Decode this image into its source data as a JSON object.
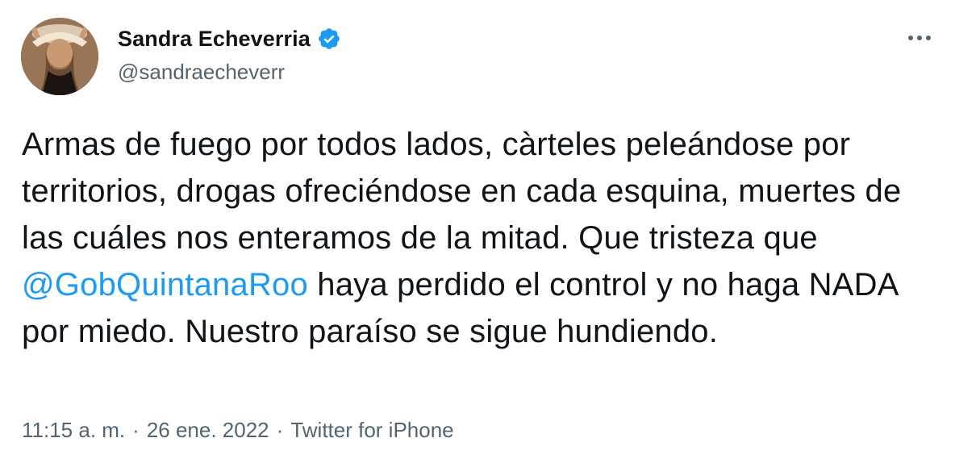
{
  "author": {
    "display_name": "Sandra Echeverria",
    "handle": "@sandraecheverr",
    "verified": true
  },
  "tweet": {
    "text_before_mention": "Armas de fuego por todos lados, càrteles peleándose por territorios, drogas ofreciéndose en cada esquina, muertes de las cuáles nos enteramos de la mitad. Que tristeza que ",
    "mention": "@GobQuintanaRoo",
    "text_after_mention": " haya perdido el control y no haga NADA por miedo. Nuestro paraíso se sigue hundiendo."
  },
  "meta": {
    "time": "11:15 a. m.",
    "separator": "·",
    "date": "26 ene. 2022",
    "source": "Twitter for iPhone"
  },
  "icons": {
    "verified": "verified-badge-icon",
    "more": "more-horizontal-icon"
  },
  "colors": {
    "text": "#0f1419",
    "secondary": "#536471",
    "accent": "#1d9bf0"
  }
}
